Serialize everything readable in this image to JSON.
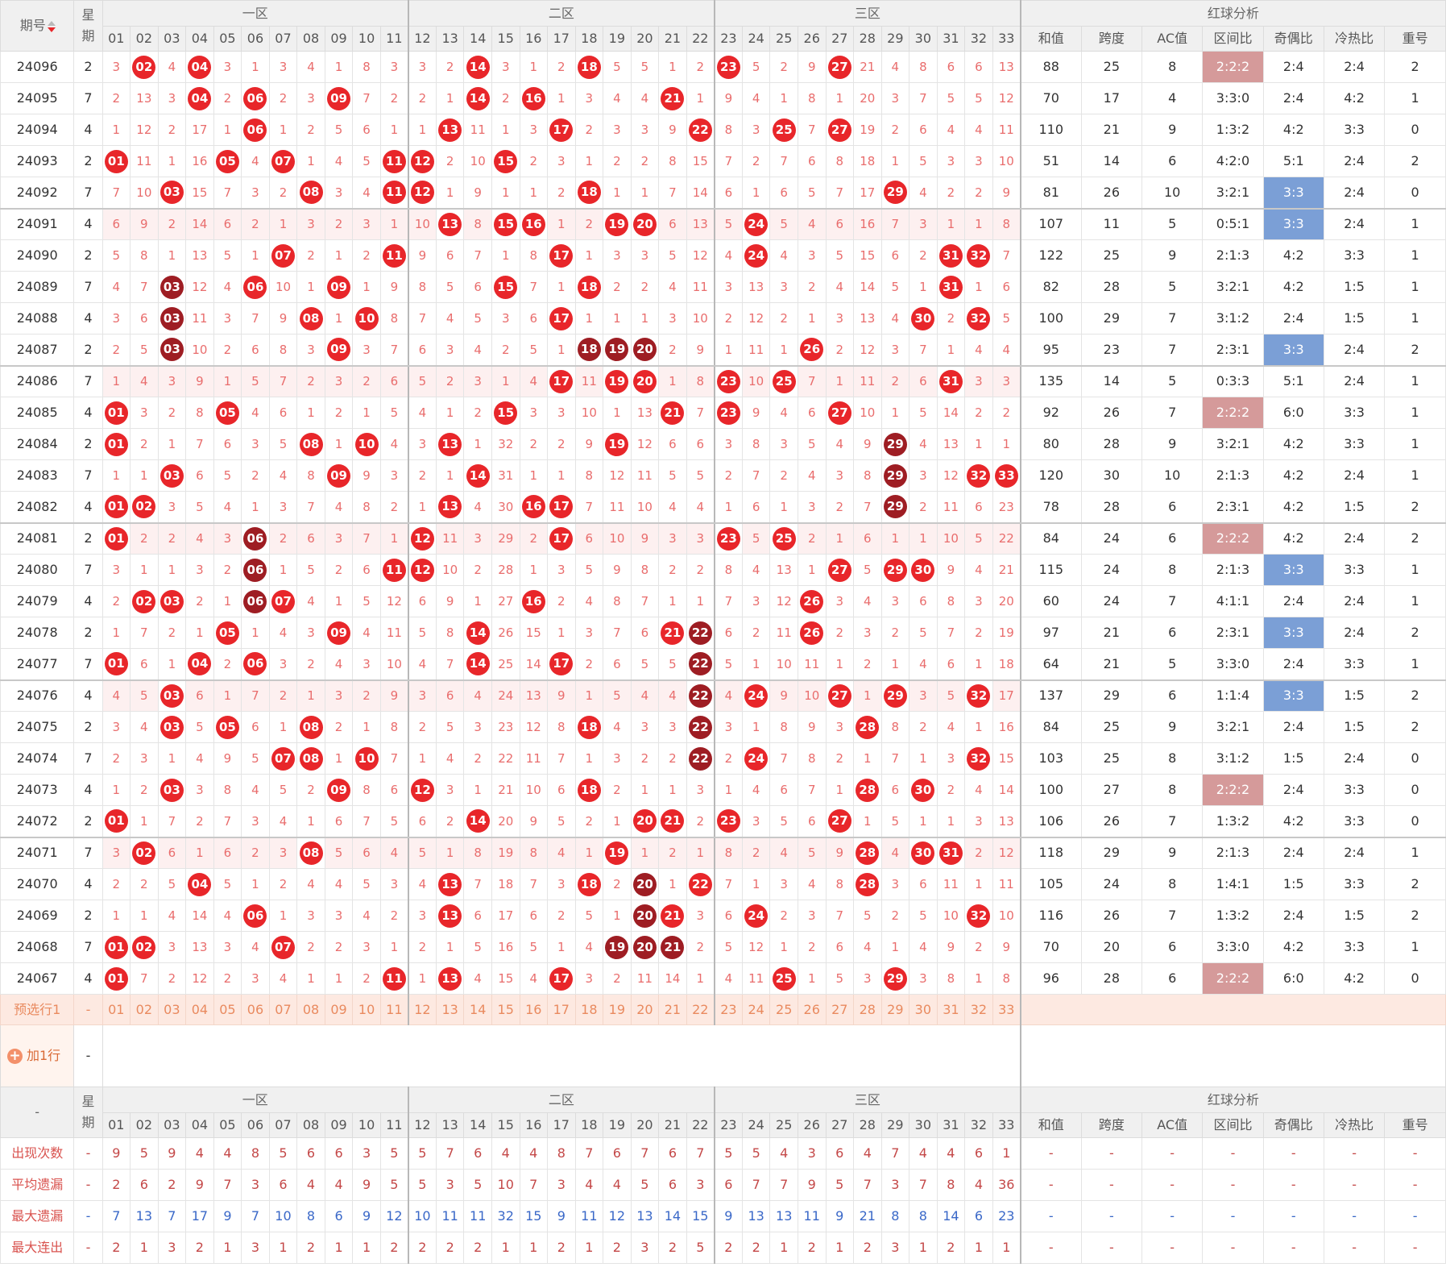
{
  "header": {
    "period": "期号",
    "week": "星期",
    "zones": [
      "一区",
      "二区",
      "三区"
    ],
    "analysis": "红球分析",
    "numbers": [
      "01",
      "02",
      "03",
      "04",
      "05",
      "06",
      "07",
      "08",
      "09",
      "10",
      "11",
      "12",
      "13",
      "14",
      "15",
      "16",
      "17",
      "18",
      "19",
      "20",
      "21",
      "22",
      "23",
      "24",
      "25",
      "26",
      "27",
      "28",
      "29",
      "30",
      "31",
      "32",
      "33"
    ],
    "stats": [
      "和值",
      "跨度",
      "AC值",
      "区间比",
      "奇偶比",
      "冷热比",
      "重号"
    ]
  },
  "colors": {
    "ball_red": "#e8262a",
    "ball_dark": "#9e1d23",
    "miss_text": "#e96d6d",
    "highlight_red": "#d59a9a",
    "highlight_blue": "#7b9fd6"
  },
  "rows": [
    {
      "p": "24096",
      "w": "2",
      "c": "3|02R|4|04R|3|1|3|4|1|8|3|3|2|14R|3|1|2|18R|5|5|1|2|23R|5|2|9|27R|21|4|8|6|6|13",
      "s": [
        "88",
        "25",
        "8",
        "2:2:2",
        "2:4",
        "2:4",
        "2"
      ],
      "hl": "3r"
    },
    {
      "p": "24095",
      "w": "7",
      "c": "2|13|3|04R|2|06R|2|3|09R|7|2|2|1|14R|2|16R|1|3|4|4|21R|1|9|4|1|8|1|20|3|7|5|5|12",
      "s": [
        "70",
        "17",
        "4",
        "3:3:0",
        "2:4",
        "4:2",
        "1"
      ]
    },
    {
      "p": "24094",
      "w": "4",
      "c": "1|12|2|17|1|06R|1|2|5|6|1|1|13R|11|1|3|17R|2|3|3|9|22R|8|3|25R|7|27R|19|2|6|4|4|11",
      "s": [
        "110",
        "21",
        "9",
        "1:3:2",
        "4:2",
        "3:3",
        "0"
      ]
    },
    {
      "p": "24093",
      "w": "2",
      "c": "01R|11|1|16|05R|4|07R|1|4|5|11R|12R|2|10|15R|2|3|1|2|2|8|15|7|2|7|6|8|18|1|5|3|3|10",
      "s": [
        "51",
        "14",
        "6",
        "4:2:0",
        "5:1",
        "2:4",
        "2"
      ]
    },
    {
      "p": "24092",
      "w": "7",
      "c": "7|10|03R|15|7|3|2|08R|3|4|11R|12R|1|9|1|1|2|18R|1|1|7|14|6|1|6|5|7|17|29R|4|2|2|9",
      "s": [
        "81",
        "26",
        "10",
        "3:2:1",
        "3:3",
        "2:4",
        "0"
      ],
      "hl": "4b",
      "gb": true
    },
    {
      "p": "24091",
      "w": "4",
      "c": "6|9|2|14|6|2|1|3|2|3|1|10|13R|8|15R|16R|1|2|19R|20R|6|13|5|24R|5|4|6|16|7|3|1|1|8",
      "s": [
        "107",
        "11",
        "5",
        "0:5:1",
        "3:3",
        "2:4",
        "1"
      ],
      "hl": "4b",
      "g": true
    },
    {
      "p": "24090",
      "w": "2",
      "c": "5|8|1|13|5|1|07R|2|1|2|11R|9|6|7|1|8|17R|1|3|3|5|12|4|24R|4|3|5|15|6|2|31R|32R|7",
      "s": [
        "122",
        "25",
        "9",
        "2:1:3",
        "4:2",
        "3:3",
        "1"
      ]
    },
    {
      "p": "24089",
      "w": "7",
      "c": "4|7|03D|12|4|06R|10|1|09R|1|9|8|5|6|15R|7|1|18R|2|2|4|11|3|13|3|2|4|14|5|1|31R|1|6",
      "s": [
        "82",
        "28",
        "5",
        "3:2:1",
        "4:2",
        "1:5",
        "1"
      ]
    },
    {
      "p": "24088",
      "w": "4",
      "c": "3|6|03D|11|3|7|9|08R|1|10R|8|7|4|5|3|6|17R|1|1|1|3|10|2|12|2|1|3|13|4|30R|2|32R|5",
      "s": [
        "100",
        "29",
        "7",
        "3:1:2",
        "2:4",
        "1:5",
        "1"
      ]
    },
    {
      "p": "24087",
      "w": "2",
      "c": "2|5|03D|10|2|6|8|3|09R|3|7|6|3|4|2|5|1|18D|19D|20D|2|9|1|11|1|26R|2|12|3|7|1|4|4",
      "s": [
        "95",
        "23",
        "7",
        "2:3:1",
        "3:3",
        "2:4",
        "2"
      ],
      "hl": "4b",
      "gb": true
    },
    {
      "p": "24086",
      "w": "7",
      "c": "1|4|3|9|1|5|7|2|3|2|6|5|2|3|1|4|17R|11|19R|20R|1|8|23R|10|25R|7|1|11|2|6|31R|3|3",
      "s": [
        "135",
        "14",
        "5",
        "0:3:3",
        "5:1",
        "2:4",
        "1"
      ],
      "g": true
    },
    {
      "p": "24085",
      "w": "4",
      "c": "01R|3|2|8|05R|4|6|1|2|1|5|4|1|2|15R|3|3|10|1|13|21R|7|23R|9|4|6|27R|10|1|5|14|2|2",
      "s": [
        "92",
        "26",
        "7",
        "2:2:2",
        "6:0",
        "3:3",
        "1"
      ],
      "hl": "3r"
    },
    {
      "p": "24084",
      "w": "2",
      "c": "01R|2|1|7|6|3|5|08R|1|10R|4|3|13R|1|32|2|2|9|19R|12|6|6|3|8|3|5|4|9|29D|4|13|1|1",
      "s": [
        "80",
        "28",
        "9",
        "3:2:1",
        "4:2",
        "3:3",
        "1"
      ]
    },
    {
      "p": "24083",
      "w": "7",
      "c": "1|1|03R|6|5|2|4|8|09R|9|3|2|1|14R|31|1|1|8|12|11|5|5|2|7|2|4|3|8|29D|3|12|32R|33R",
      "s": [
        "120",
        "30",
        "10",
        "2:1:3",
        "4:2",
        "2:4",
        "1"
      ]
    },
    {
      "p": "24082",
      "w": "4",
      "c": "01R|02R|3|5|4|1|3|7|4|8|2|1|13R|4|30|16R|17R|7|11|10|4|4|1|6|1|3|2|7|29D|2|11|6|23",
      "s": [
        "78",
        "28",
        "6",
        "2:3:1",
        "4:2",
        "1:5",
        "2"
      ],
      "gb": true
    },
    {
      "p": "24081",
      "w": "2",
      "c": "01R|2|2|4|3|06D|2|6|3|7|1|12R|11|3|29|2|17R|6|10|9|3|3|23R|5|25R|2|1|6|1|1|10|5|22",
      "s": [
        "84",
        "24",
        "6",
        "2:2:2",
        "4:2",
        "2:4",
        "2"
      ],
      "hl": "3r",
      "g": true
    },
    {
      "p": "24080",
      "w": "7",
      "c": "3|1|1|3|2|06D|1|5|2|6|11R|12R|10|2|28|1|3|5|9|8|2|2|8|4|13|1|27R|5|29R|30R|9|4|21",
      "s": [
        "115",
        "24",
        "8",
        "2:1:3",
        "3:3",
        "3:3",
        "1"
      ],
      "hl": "4b"
    },
    {
      "p": "24079",
      "w": "4",
      "c": "2|02R|03R|2|1|06D|07R|4|1|5|12|6|9|1|27|16R|2|4|8|7|1|1|7|3|12|26R|3|4|3|6|8|3|20",
      "s": [
        "60",
        "24",
        "7",
        "4:1:1",
        "2:4",
        "2:4",
        "1"
      ]
    },
    {
      "p": "24078",
      "w": "2",
      "c": "1|7|2|1|05R|1|4|3|09R|4|11|5|8|14R|26|15|1|3|7|6|21R|22D|6|2|11|26R|2|3|2|5|7|2|19",
      "s": [
        "97",
        "21",
        "6",
        "2:3:1",
        "3:3",
        "2:4",
        "2"
      ],
      "hl": "4b"
    },
    {
      "p": "24077",
      "w": "7",
      "c": "01R|6|1|04R|2|06R|3|2|4|3|10|4|7|14R|25|14|17R|2|6|5|5|22D|5|1|10|11|1|2|1|4|6|1|18",
      "s": [
        "64",
        "21",
        "5",
        "3:3:0",
        "2:4",
        "3:3",
        "1"
      ],
      "gb": true
    },
    {
      "p": "24076",
      "w": "4",
      "c": "4|5|03R|6|1|7|2|1|3|2|9|3|6|4|24|13|9|1|5|4|4|22D|4|24R|9|10|27R|1|29R|3|5|32R|17",
      "s": [
        "137",
        "29",
        "6",
        "1:1:4",
        "3:3",
        "1:5",
        "2"
      ],
      "hl": "4b",
      "g": true
    },
    {
      "p": "24075",
      "w": "2",
      "c": "3|4|03R|5|05R|6|1|08R|2|1|8|2|5|3|23|12|8|18R|4|3|3|22D|3|1|8|9|3|28R|8|2|4|1|16",
      "s": [
        "84",
        "25",
        "9",
        "3:2:1",
        "2:4",
        "1:5",
        "2"
      ]
    },
    {
      "p": "24074",
      "w": "7",
      "c": "2|3|1|4|9|5|07R|08R|1|10R|7|1|4|2|22|11|7|1|3|2|2|22D|2|24R|7|8|2|1|7|1|3|32R|15",
      "s": [
        "103",
        "25",
        "8",
        "3:1:2",
        "1:5",
        "2:4",
        "0"
      ]
    },
    {
      "p": "24073",
      "w": "4",
      "c": "1|2|03R|3|8|4|5|2|09R|8|6|12R|3|1|21|10|6|18R|2|1|1|3|1|4|6|7|1|28R|6|30R|2|4|14",
      "s": [
        "100",
        "27",
        "8",
        "2:2:2",
        "2:4",
        "3:3",
        "0"
      ],
      "hl": "3r"
    },
    {
      "p": "24072",
      "w": "2",
      "c": "01R|1|7|2|7|3|4|1|6|7|5|6|2|14R|20|9|5|2|1|20R|21R|2|23R|3|5|6|27R|1|5|1|1|3|13",
      "s": [
        "106",
        "26",
        "7",
        "1:3:2",
        "4:2",
        "3:3",
        "0"
      ],
      "gb": true
    },
    {
      "p": "24071",
      "w": "7",
      "c": "3|02R|6|1|6|2|3|08R|5|6|4|5|1|8|19|8|4|1|19R|1|2|1|8|2|4|5|9|28R|4|30R|31R|2|12",
      "s": [
        "118",
        "29",
        "9",
        "2:1:3",
        "2:4",
        "2:4",
        "1"
      ],
      "g": true
    },
    {
      "p": "24070",
      "w": "4",
      "c": "2|2|5|04R|5|1|2|4|4|5|3|4|13R|7|18|7|3|18R|2|20D|1|22R|7|1|3|4|8|28R|3|6|11|1|11",
      "s": [
        "105",
        "24",
        "8",
        "1:4:1",
        "1:5",
        "3:3",
        "2"
      ]
    },
    {
      "p": "24069",
      "w": "2",
      "c": "1|1|4|14|4|06R|1|3|3|4|2|3|13R|6|17|6|2|5|1|20D|21R|3|6|24R|2|3|7|5|2|5|10|32R|10",
      "s": [
        "116",
        "26",
        "7",
        "1:3:2",
        "2:4",
        "1:5",
        "2"
      ]
    },
    {
      "p": "24068",
      "w": "7",
      "c": "01R|02R|3|13|3|4|07R|2|2|3|1|2|1|5|16|5|1|4|19D|20D|21D|2|5|12|1|2|6|4|1|4|9|2|9",
      "s": [
        "70",
        "20",
        "6",
        "3:3:0",
        "4:2",
        "3:3",
        "1"
      ]
    },
    {
      "p": "24067",
      "w": "4",
      "c": "01R|7|2|12|2|3|4|1|1|2|11R|1|13R|4|15|4|17R|3|2|11|14|1|4|11|25R|1|5|3|29R|3|8|1|8",
      "s": [
        "96",
        "28",
        "6",
        "2:2:2",
        "6:0",
        "4:2",
        "0"
      ],
      "hl": "3r"
    }
  ],
  "preselect": {
    "label": "预选行1",
    "week": "-"
  },
  "add_row": {
    "label": "加1行",
    "week": "-"
  },
  "footer_header": {
    "period": "-"
  },
  "stat_rows": [
    {
      "label": "出现次数",
      "w": "-",
      "v": [
        "9",
        "5",
        "9",
        "4",
        "4",
        "8",
        "5",
        "6",
        "6",
        "3",
        "5",
        "5",
        "7",
        "6",
        "4",
        "4",
        "8",
        "7",
        "6",
        "7",
        "6",
        "7",
        "5",
        "5",
        "4",
        "3",
        "6",
        "4",
        "7",
        "4",
        "4",
        "6",
        "1"
      ]
    },
    {
      "label": "平均遗漏",
      "w": "-",
      "v": [
        "2",
        "6",
        "2",
        "9",
        "7",
        "3",
        "6",
        "4",
        "4",
        "9",
        "5",
        "5",
        "3",
        "5",
        "10",
        "7",
        "3",
        "4",
        "4",
        "5",
        "6",
        "3",
        "6",
        "7",
        "7",
        "9",
        "5",
        "7",
        "3",
        "7",
        "8",
        "4",
        "36"
      ]
    },
    {
      "label": "最大遗漏",
      "w": "-",
      "v": [
        "7",
        "13",
        "7",
        "17",
        "9",
        "7",
        "10",
        "8",
        "6",
        "9",
        "12",
        "10",
        "11",
        "11",
        "32",
        "15",
        "9",
        "11",
        "12",
        "13",
        "14",
        "15",
        "9",
        "13",
        "13",
        "11",
        "9",
        "21",
        "8",
        "8",
        "14",
        "6",
        "23"
      ]
    },
    {
      "label": "最大连出",
      "w": "-",
      "v": [
        "2",
        "1",
        "3",
        "2",
        "1",
        "3",
        "1",
        "2",
        "1",
        "1",
        "2",
        "2",
        "2",
        "2",
        "1",
        "1",
        "2",
        "1",
        "2",
        "3",
        "2",
        "5",
        "2",
        "2",
        "1",
        "2",
        "1",
        "2",
        "3",
        "1",
        "2",
        "1",
        "1"
      ]
    }
  ],
  "dash": "-"
}
